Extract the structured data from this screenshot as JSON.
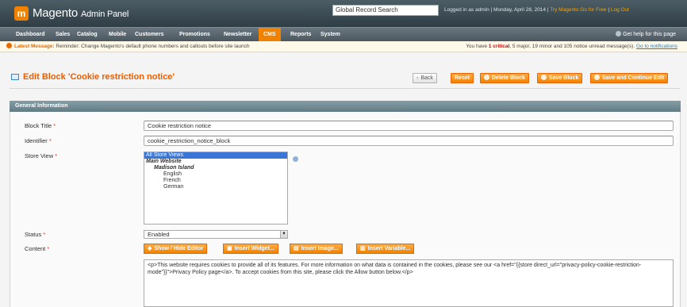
{
  "header": {
    "logo_glyph": "m",
    "brand": "Magento",
    "brand_sub": "Admin Panel",
    "search_value": "Global Record Search",
    "user_text": "Logged in as admin  |  Monday, April 28, 2014  |  ",
    "try_link": "Try Magento Go for Free",
    "separator": "  |  ",
    "logout": "Log Out"
  },
  "nav": {
    "items": [
      "Dashboard",
      "Sales",
      "Catalog",
      "Mobile",
      "Customers",
      "Promotions",
      "Newsletter",
      "CMS",
      "Reports",
      "System"
    ],
    "help": "Get help for this page"
  },
  "messages": {
    "latest_label": "Latest Message:",
    "latest_text": " Reminder: Change Magento's default phone numbers and callouts before site launch",
    "summary_pre": "You have ",
    "critical": "1 critical",
    "summary_post": ", 5 major, 19 minor and 105 notice unread message(s). ",
    "goto": "Go to notifications"
  },
  "page": {
    "title": "Edit Block 'Cookie restriction notice'",
    "buttons": {
      "back": "Back",
      "reset": "Reset",
      "delete": "Delete Block",
      "save": "Save Block",
      "save_continue": "Save and Continue Edit"
    }
  },
  "section": {
    "title": "General Information"
  },
  "form": {
    "block_title_label": "Block Title",
    "block_title_value": "Cookie restriction notice",
    "identifier_label": "Identifier",
    "identifier_value": "cookie_restriction_notice_block",
    "store_view_label": "Store View",
    "store_views": {
      "all": "All Store Views",
      "website": "Main Website",
      "store": "Madison Island",
      "views": [
        "English",
        "French",
        "German"
      ]
    },
    "status_label": "Status",
    "status_value": "Enabled",
    "content_label": "Content",
    "editor_buttons": {
      "show_hide": "Show / Hide Editor",
      "widget": "Insert Widget...",
      "image": "Insert Image...",
      "variable": "Insert Variable..."
    },
    "content_value": "<p>This website requires cookies to provide all of its features. For more information on what data is contained in the cookies, please see our <a href=\"{{store direct_url=\"privacy-policy-cookie-restriction-mode\"}}\">Privacy Policy page</a>. To accept cookies from this site, please click the Allow button below.</p>"
  },
  "required_mark": "*",
  "colors": {
    "accent": "#f18200",
    "header": "#3a4a54",
    "title": "#eb5e00",
    "section": "#6f8992"
  }
}
